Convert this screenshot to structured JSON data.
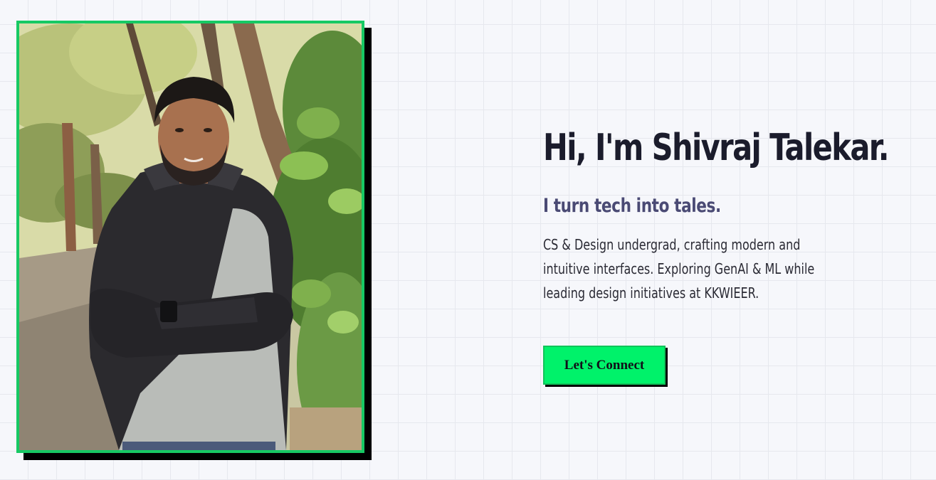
{
  "hero": {
    "title": "Hi, I'm Shivraj Talekar.",
    "tagline": "I turn tech into tales.",
    "description_lines": [
      "CS & Design undergrad, crafting modern and",
      "intuitive interfaces. Exploring GenAI & ML while",
      "leading design initiatives at KKWIEER."
    ],
    "cta_label": "Let's Connect"
  },
  "photo": {
    "subject": "profile-photo"
  },
  "colors": {
    "accent": "#00f26a",
    "frame": "#17c964",
    "title": "#1b1c2c",
    "tagline": "#4a4a74",
    "background": "#f6f7fb"
  }
}
